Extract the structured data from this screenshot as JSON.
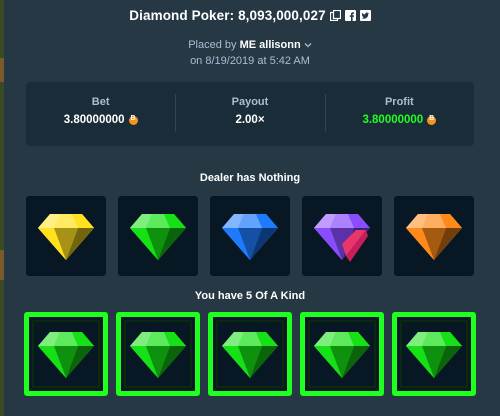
{
  "title": {
    "text": "Diamond Poker: 8,093,000,027"
  },
  "placed": {
    "prefix": "Placed by",
    "user": "ME allisonn",
    "date": "on 8/19/2019 at 5:42 AM"
  },
  "stats": [
    {
      "label": "Bet",
      "value": "3.80000000",
      "currency_icon": "btc-coin-icon"
    },
    {
      "label": "Payout",
      "value": "2.00×"
    },
    {
      "label": "Profit",
      "value": "3.80000000",
      "currency_icon": "btc-coin-icon"
    }
  ],
  "dealer": {
    "label": "Dealer has Nothing",
    "gems": [
      "yellow",
      "green",
      "blue",
      "purple",
      "orange"
    ]
  },
  "player": {
    "label": "You have 5 Of A Kind",
    "gems": [
      "green",
      "green",
      "green",
      "green",
      "green"
    ]
  },
  "colors": {
    "background": "#253843",
    "panel": "#1a2c38",
    "profit_green": "#1fff20",
    "win_border": "#1fff20",
    "gem_yellow": "#ffe11f",
    "gem_green": "#16e016",
    "gem_blue": "#1e7bff",
    "gem_purple": "#8a4cff",
    "gem_orange": "#ff8a1a"
  }
}
